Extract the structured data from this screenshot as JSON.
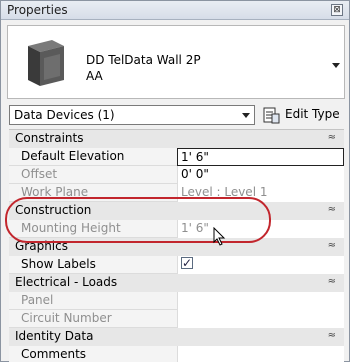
{
  "window": {
    "title": "Properties",
    "close_glyph": "⊠"
  },
  "type": {
    "name": "DD TelData Wall 2P",
    "subname": "AA",
    "thumbnail_icon": "device-thumbnail-icon",
    "dropdown_icon": "dropdown-arrow-icon"
  },
  "selector": {
    "value": "Data Devices (1)",
    "edit_type_label": "Edit Type"
  },
  "categories": [
    {
      "label": "Constraints",
      "collapse": "≈"
    },
    {
      "label": "Construction",
      "collapse": "≈"
    },
    {
      "label": "Graphics",
      "collapse": "≈"
    },
    {
      "label": "Electrical - Loads",
      "collapse": "≈"
    },
    {
      "label": "Identity Data",
      "collapse": "≈"
    }
  ],
  "properties": {
    "default_elevation": {
      "label": "Default Elevation",
      "value": "1'  6\""
    },
    "offset": {
      "label": "Offset",
      "value": "0'  0\""
    },
    "work_plane": {
      "label": "Work Plane",
      "value": "Level : Level 1"
    },
    "mounting_height": {
      "label": "Mounting Height",
      "value": "1'  6\""
    },
    "show_labels": {
      "label": "Show Labels",
      "checked": "✓"
    },
    "panel": {
      "label": "Panel",
      "value": ""
    },
    "circuit_number": {
      "label": "Circuit Number",
      "value": ""
    },
    "comments": {
      "label": "Comments",
      "value": ""
    }
  },
  "colors": {
    "annotation_ellipse": "#c2262d"
  }
}
